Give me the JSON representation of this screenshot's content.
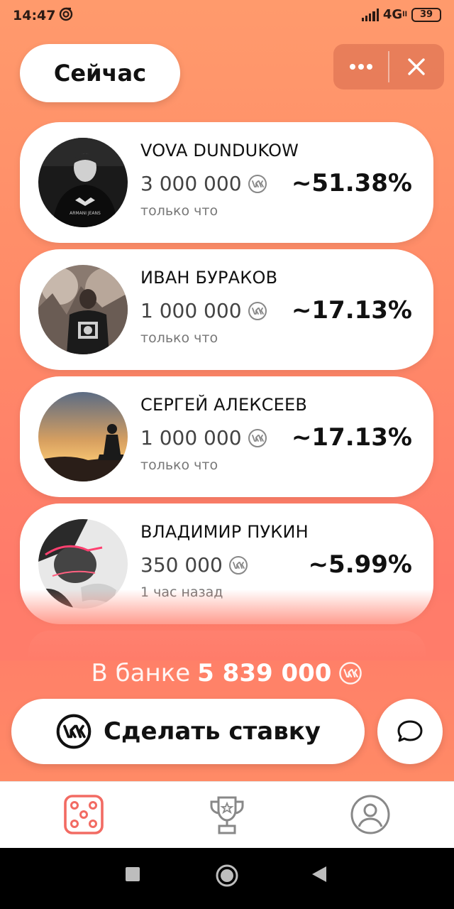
{
  "status_bar": {
    "time": "14:47",
    "network": "4G",
    "network_sub": "ll",
    "battery": "39"
  },
  "header": {
    "title": "Сейчас",
    "more_icon": "more-dots-icon",
    "close_icon": "close-icon"
  },
  "bets": [
    {
      "name": "VOVA DUNDUKOW",
      "amount": "3 000 000",
      "time": "только что",
      "percent": "~51.38%"
    },
    {
      "name": "ИВАН БУРАКОВ",
      "amount": "1 000 000",
      "time": "только что",
      "percent": "~17.13%"
    },
    {
      "name": "СЕРГЕЙ АЛЕКСЕЕВ",
      "amount": "1 000 000",
      "time": "только что",
      "percent": "~17.13%"
    },
    {
      "name": "ВЛАДИМИР ПУКИН",
      "amount": "350 000",
      "time": "1 час назад",
      "percent": "~5.99%"
    }
  ],
  "bank": {
    "label": "В банке",
    "amount": "5 839 000"
  },
  "actions": {
    "bet_label": "Сделать ставку",
    "chat_icon": "chat-bubble-icon"
  },
  "tabs": [
    {
      "icon": "dice-icon",
      "active": true
    },
    {
      "icon": "trophy-icon",
      "active": false
    },
    {
      "icon": "profile-icon",
      "active": false
    }
  ],
  "colors": {
    "accent": "#f26b63",
    "background_top": "#ff9a6c",
    "background_bottom": "#ff7a6a"
  }
}
